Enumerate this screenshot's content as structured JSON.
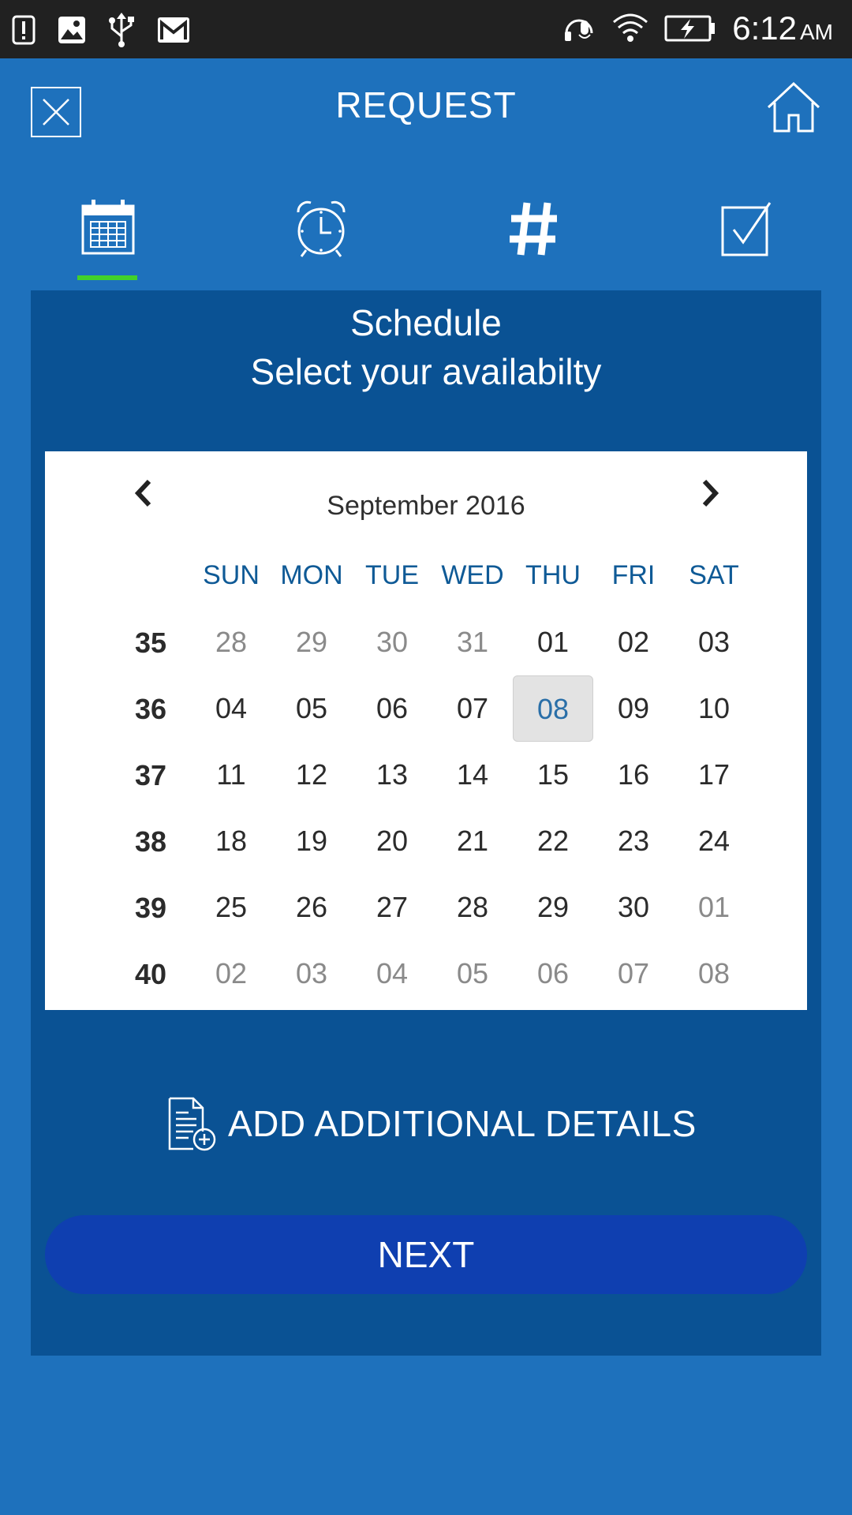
{
  "status_bar": {
    "time": "6:12",
    "ampm": "AM",
    "left_icons": [
      "alert-icon",
      "image-icon",
      "usb-icon",
      "gmail-icon"
    ],
    "right_icons": [
      "headset-icon",
      "wifi-icon",
      "battery-charging-icon"
    ]
  },
  "header": {
    "title": "REQUEST",
    "close_icon": "close-icon",
    "home_icon": "home-icon"
  },
  "tabs": [
    {
      "name": "calendar",
      "icon": "calendar-icon",
      "active": true
    },
    {
      "name": "alarm",
      "icon": "alarm-clock-icon",
      "active": false
    },
    {
      "name": "number",
      "icon": "hash-icon",
      "active": false
    },
    {
      "name": "confirm",
      "icon": "checkbox-icon",
      "active": false
    }
  ],
  "colors": {
    "background": "#1e71bc",
    "panel": "#0a5294",
    "accent_underline": "#41d12a",
    "next_button": "#0f3fb0",
    "weekday_text": "#0f5a96"
  },
  "panel": {
    "title": "Schedule",
    "subtitle": "Select your availabilty"
  },
  "calendar": {
    "month_label": "September 2016",
    "weekdays": [
      "SUN",
      "MON",
      "TUE",
      "WED",
      "THU",
      "FRI",
      "SAT"
    ],
    "weeks": [
      {
        "week": "35",
        "days": [
          {
            "d": "28",
            "other": true
          },
          {
            "d": "29",
            "other": true
          },
          {
            "d": "30",
            "other": true
          },
          {
            "d": "31",
            "other": true
          },
          {
            "d": "01"
          },
          {
            "d": "02"
          },
          {
            "d": "03"
          }
        ]
      },
      {
        "week": "36",
        "days": [
          {
            "d": "04"
          },
          {
            "d": "05"
          },
          {
            "d": "06"
          },
          {
            "d": "07"
          },
          {
            "d": "08",
            "selected": true
          },
          {
            "d": "09"
          },
          {
            "d": "10"
          }
        ]
      },
      {
        "week": "37",
        "days": [
          {
            "d": "11"
          },
          {
            "d": "12"
          },
          {
            "d": "13"
          },
          {
            "d": "14"
          },
          {
            "d": "15"
          },
          {
            "d": "16"
          },
          {
            "d": "17"
          }
        ]
      },
      {
        "week": "38",
        "days": [
          {
            "d": "18"
          },
          {
            "d": "19"
          },
          {
            "d": "20"
          },
          {
            "d": "21"
          },
          {
            "d": "22"
          },
          {
            "d": "23"
          },
          {
            "d": "24"
          }
        ]
      },
      {
        "week": "39",
        "days": [
          {
            "d": "25"
          },
          {
            "d": "26"
          },
          {
            "d": "27"
          },
          {
            "d": "28"
          },
          {
            "d": "29"
          },
          {
            "d": "30"
          },
          {
            "d": "01",
            "other": true
          }
        ]
      },
      {
        "week": "40",
        "days": [
          {
            "d": "02",
            "other": true
          },
          {
            "d": "03",
            "other": true
          },
          {
            "d": "04",
            "other": true
          },
          {
            "d": "05",
            "other": true
          },
          {
            "d": "06",
            "other": true
          },
          {
            "d": "07",
            "other": true
          },
          {
            "d": "08",
            "other": true
          }
        ]
      }
    ]
  },
  "details": {
    "label": "ADD ADDITIONAL DETAILS",
    "icon": "document-add-icon"
  },
  "next_button": {
    "label": "NEXT"
  }
}
